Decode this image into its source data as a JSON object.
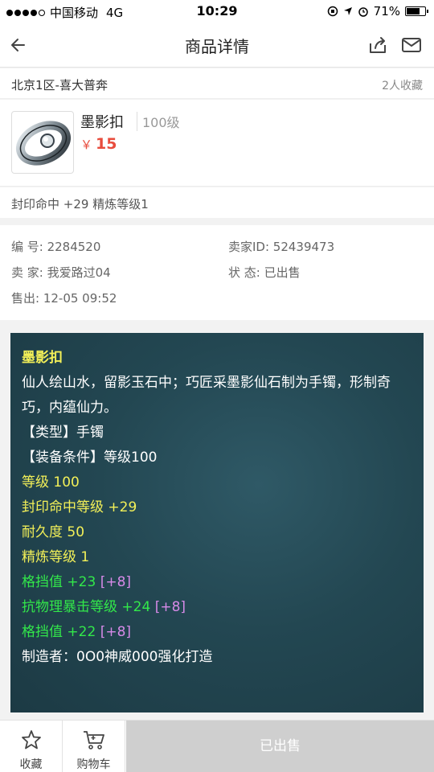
{
  "status_bar": {
    "carrier": "中国移动",
    "network": "4G",
    "time": "10:29",
    "battery": "71%"
  },
  "nav": {
    "title": "商品详情"
  },
  "server": {
    "name": "北京1区-喜大普奔",
    "favorites": "2人收藏"
  },
  "item": {
    "name": "墨影扣",
    "level": "100级",
    "currency": "￥",
    "price": "15",
    "attributes": "封印命中 +29 精炼等级1"
  },
  "info": {
    "id": "编  号: 2284520",
    "seller_id": "卖家ID: 52439473",
    "seller": "卖  家: 我爱路过04",
    "status": "状  态: 已出售",
    "sold_at": "售出: 12-05 09:52"
  },
  "description": {
    "title": "墨影扣",
    "lore": "仙人绘山水，留影玉石中；巧匠采墨影仙石制为手镯，形制奇巧，内蕴仙力。",
    "type": "【类型】手镯",
    "requirement": "【装备条件】等级100",
    "level": "等级 100",
    "seal_hit": "封印命中等级 +29",
    "durability": "耐久度 50",
    "refine": "精炼等级 1",
    "block1": "格挡值 +23",
    "block1_bonus": "[+8]",
    "anti_crit": "抗物理暴击等级 +24",
    "anti_crit_bonus": "[+8]",
    "block2": "格挡值 +22",
    "block2_bonus": "[+8]",
    "maker": "制造者：0O0神威000强化打造"
  },
  "bottom": {
    "favorite_label": "收藏",
    "cart_label": "购物车",
    "sold_label": "已出售"
  },
  "colors": {
    "price": "#e84c3d",
    "desc_yellow": "#f3f058",
    "desc_green": "#32e84a",
    "desc_purple": "#d78ae8"
  }
}
